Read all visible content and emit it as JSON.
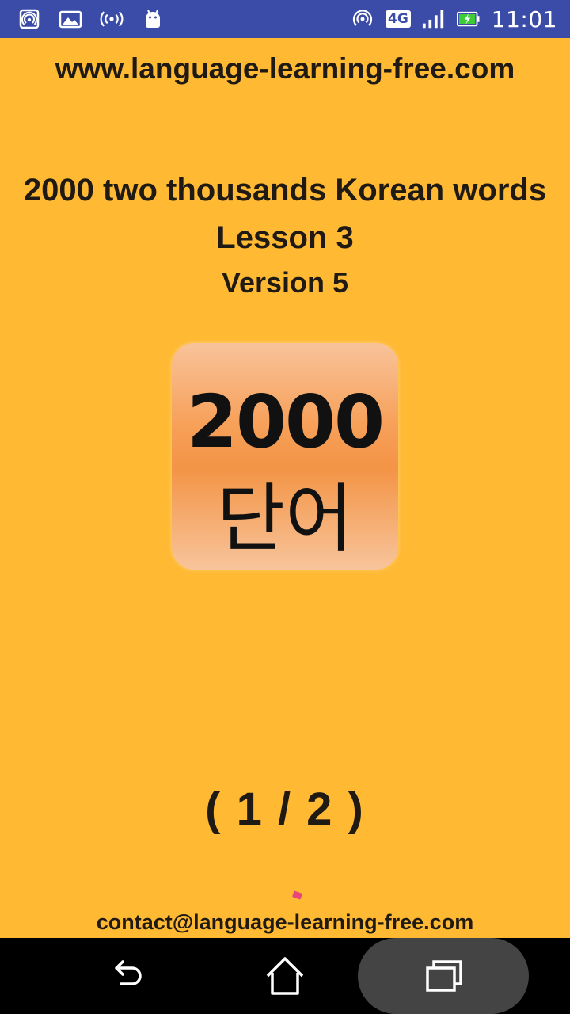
{
  "status_bar": {
    "time": "11:01",
    "network_type": "4G",
    "left_icons": [
      "hotspot-icon",
      "image-icon",
      "broadcast-icon",
      "android-icon"
    ],
    "right_icons": [
      "hotspot-icon",
      "signal-icon",
      "battery-charging-icon"
    ]
  },
  "header": {
    "website": "www.language-learning-free.com"
  },
  "main": {
    "title": "2000 two thousands Korean words",
    "lesson": "Lesson 3",
    "version": "Version 5",
    "logo": {
      "number": "2000",
      "word": "단어"
    },
    "pager": "( 1 / 2 )"
  },
  "footer": {
    "contact": "contact@language-learning-free.com"
  },
  "nav_bar": {
    "icons": [
      "back-icon",
      "home-icon",
      "recents-icon"
    ]
  },
  "colors": {
    "background": "#FFB933",
    "status_bar": "#3B4CA8",
    "text": "#1f1a14",
    "logo_orange": "#F39445"
  }
}
